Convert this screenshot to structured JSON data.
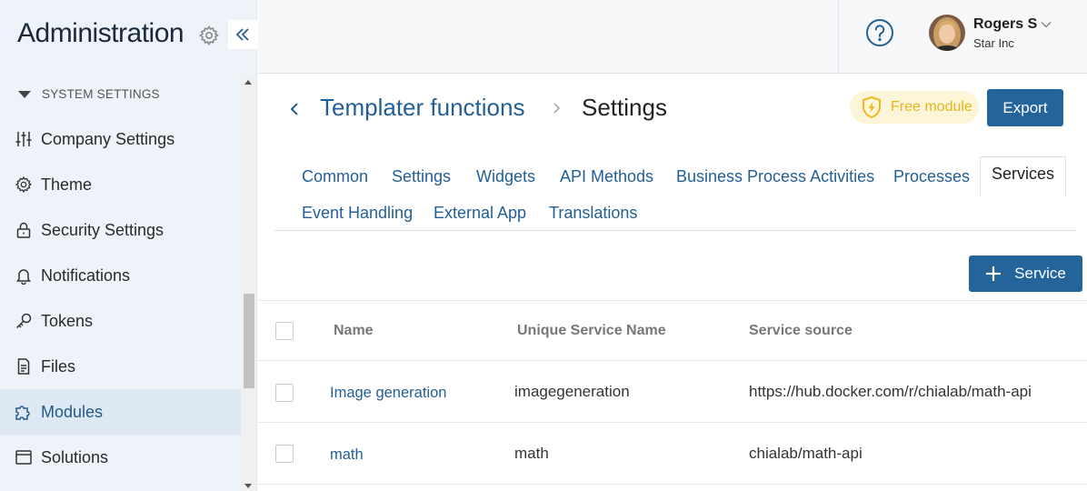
{
  "sidebar": {
    "title": "Administration",
    "section": "SYSTEM SETTINGS",
    "items": [
      {
        "label": "Company Settings",
        "icon": "sliders-icon"
      },
      {
        "label": "Theme",
        "icon": "gear-icon"
      },
      {
        "label": "Security Settings",
        "icon": "lock-icon"
      },
      {
        "label": "Notifications",
        "icon": "bell-icon"
      },
      {
        "label": "Tokens",
        "icon": "key-icon"
      },
      {
        "label": "Files",
        "icon": "file-icon"
      },
      {
        "label": "Modules",
        "icon": "puzzle-icon",
        "active": true
      },
      {
        "label": "Solutions",
        "icon": "window-icon"
      }
    ]
  },
  "header": {
    "user_name": "Rogers S",
    "user_org": "Star Inc"
  },
  "breadcrumb": {
    "parent": "Templater functions",
    "current": "Settings"
  },
  "badge": "Free module",
  "export_label": "Export",
  "tabs": [
    {
      "label": "Common"
    },
    {
      "label": "Settings"
    },
    {
      "label": "Widgets"
    },
    {
      "label": "API Methods"
    },
    {
      "label": "Business Process Activities"
    },
    {
      "label": "Processes"
    },
    {
      "label": "Services",
      "selected": true
    },
    {
      "label": "Event Handling"
    },
    {
      "label": "External App"
    },
    {
      "label": "Translations"
    }
  ],
  "add_service_label": "Service",
  "table": {
    "columns": [
      "Name",
      "Unique Service Name",
      "Service source"
    ],
    "rows": [
      {
        "name": "Image generation",
        "unique": "imagegeneration",
        "source": "https://hub.docker.com/r/chialab/math-api"
      },
      {
        "name": "math",
        "unique": "math",
        "source": "chialab/math-api"
      }
    ]
  },
  "colors": {
    "accent": "#24649b",
    "link": "#235f95",
    "badge_text": "#e3b61a",
    "badge_bg": "#fdf5d8",
    "sidebar_bg": "#edf3f8"
  }
}
